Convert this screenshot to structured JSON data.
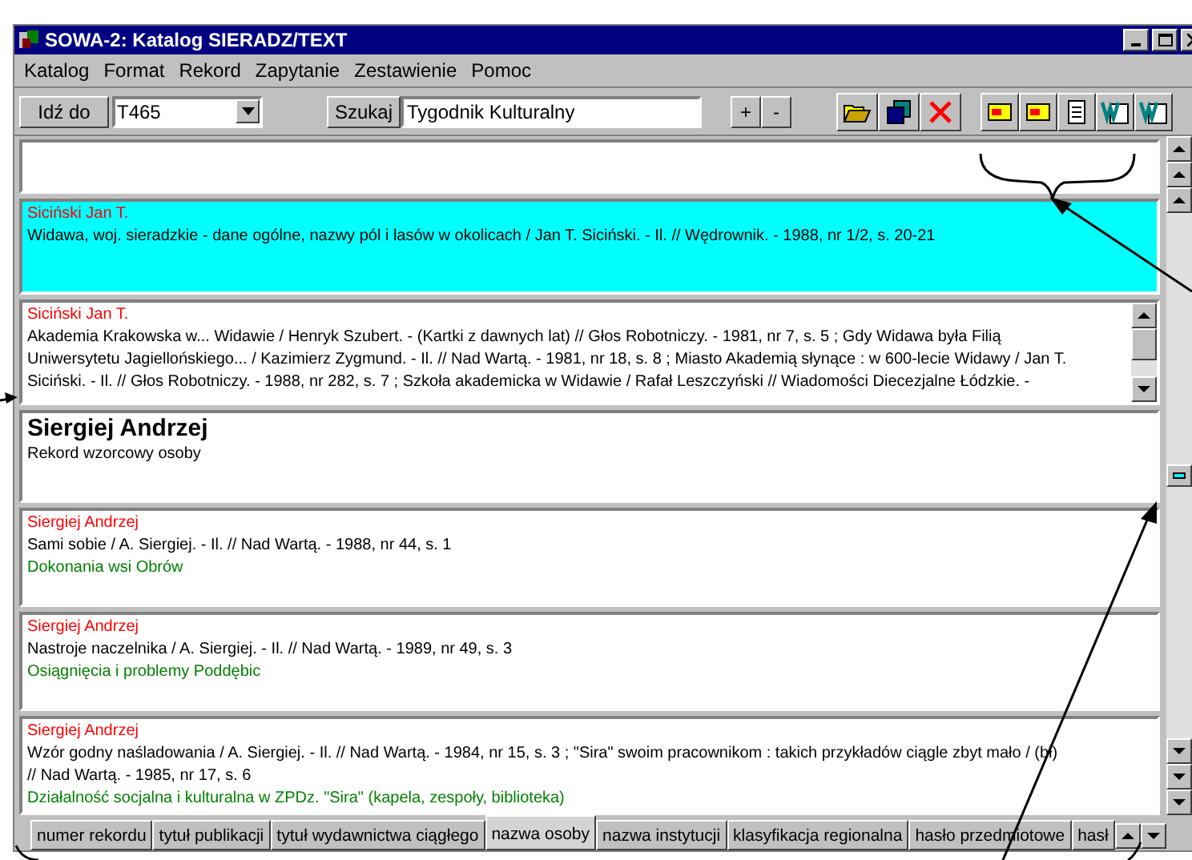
{
  "window": {
    "title": "SOWA-2: Katalog SIERADZ/TEXT"
  },
  "menu": [
    {
      "label": "Katalog"
    },
    {
      "label": "Format"
    },
    {
      "label": "Rekord"
    },
    {
      "label": "Zapytanie"
    },
    {
      "label": "Zestawienie"
    },
    {
      "label": "Pomoc"
    }
  ],
  "toolbar": {
    "goto_button": "Idź do",
    "goto_value": "T465",
    "search_button": "Szukaj",
    "search_value": "Tygodnik Kulturalny",
    "plus": "+",
    "minus": "-"
  },
  "records": [
    {
      "kind": "empty",
      "selected": false
    },
    {
      "kind": "entry",
      "selected": true,
      "author": "Siciński Jan T.",
      "lines": [
        "Widawa, woj. sieradzkie - dane ogólne, nazwy pól i lasów w okolicach / Jan T. Siciński. - Il. // Wędrownik. - 1988, nr 1/2, s. 20-21"
      ]
    },
    {
      "kind": "entry",
      "selected": false,
      "scroll": true,
      "author": "Siciński Jan T.",
      "lines": [
        "Akademia Krakowska w... Widawie / Henryk Szubert. - (Kartki z dawnych lat) // Głos Robotniczy. - 1981, nr 7, s. 5 ; Gdy Widawa była Filią",
        "Uniwersytetu Jagiellońskiego... / Kazimierz Zygmund. - Il. // Nad Wartą. - 1981, nr 18, s. 8 ; Miasto Akademią słynące : w 600-lecie Widawy / Jan T.",
        "Siciński. - Il. // Głos Robotniczy. - 1988, nr 282, s. 7 ; Szkoła akademicka w Widawie / Rafał Leszczyński // Wiadomości Diecezjalne Łódzkie. -"
      ]
    },
    {
      "kind": "heading",
      "selected": false,
      "author": "Siergiej Andrzej",
      "note": "Rekord wzorcowy osoby"
    },
    {
      "kind": "entry",
      "selected": false,
      "author": "Siergiej Andrzej",
      "lines": [
        "Sami sobie / A. Siergiej. - Il. // Nad Wartą. - 1988, nr 44, s. 1"
      ],
      "subject": "Dokonania wsi Obrów"
    },
    {
      "kind": "entry",
      "selected": false,
      "author": "Siergiej Andrzej",
      "lines": [
        "Nastroje naczelnika / A. Siergiej. - Il. // Nad Wartą. - 1989, nr 49, s. 3"
      ],
      "subject": "Osiągnięcia i problemy Poddębic"
    },
    {
      "kind": "entry",
      "selected": false,
      "author": "Siergiej Andrzej",
      "lines": [
        "Wzór godny naśladowania / A. Siergiej. - Il. // Nad Wartą. - 1984, nr 15, s. 3 ; \"Sira\" swoim pracownikom : takich przykładów ciągle zbyt mało / (bł)",
        "// Nad Wartą. - 1985, nr 17, s. 6"
      ],
      "subject": "Działalność socjalna i kulturalna w ZPDz. \"Sira\" (kapela, zespoły, biblioteka)"
    }
  ],
  "tabs": [
    {
      "label": "numer rekordu",
      "selected": false
    },
    {
      "label": "tytuł publikacji",
      "selected": false
    },
    {
      "label": "tytuł wydawnictwa ciągłego",
      "selected": false
    },
    {
      "label": "nazwa osoby",
      "selected": true
    },
    {
      "label": "nazwa instytucji",
      "selected": false
    },
    {
      "label": "klasyfikacja regionalna",
      "selected": false
    },
    {
      "label": "hasło przedmiotowe",
      "selected": false
    },
    {
      "label": "hasł",
      "selected": false
    }
  ]
}
